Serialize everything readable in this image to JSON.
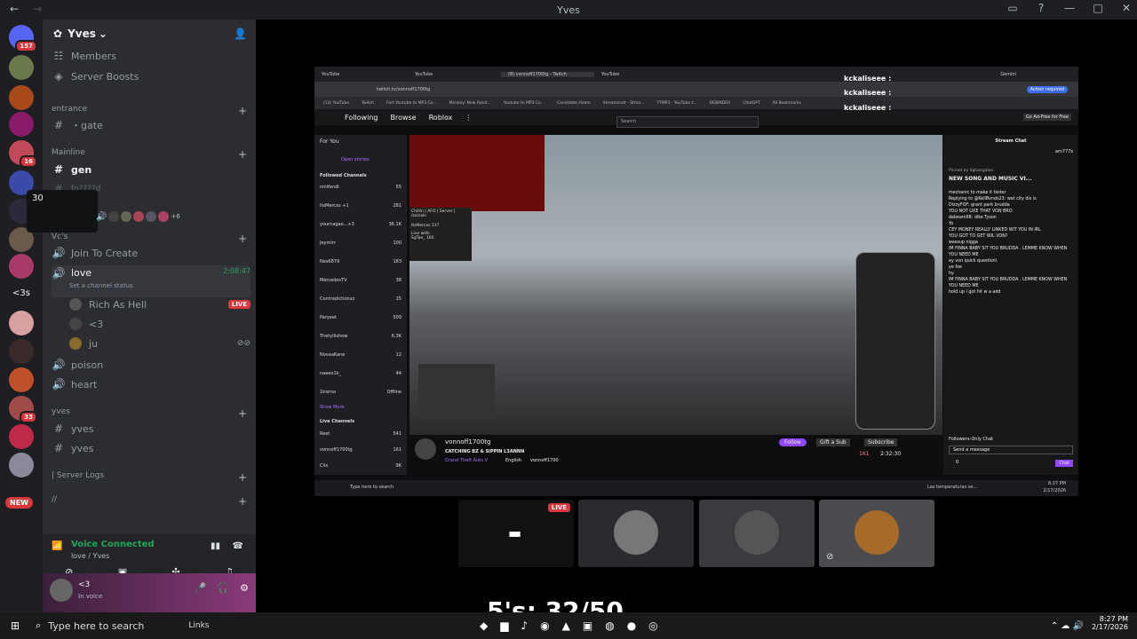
{
  "window": {
    "title": "Yves"
  },
  "servers": [
    {
      "badge": "157"
    },
    {
      "badge": ""
    },
    {
      "badge": ""
    },
    {
      "badge": "16"
    },
    {
      "badge": ""
    },
    {
      "badge": ""
    },
    {
      "badge": ""
    },
    {
      "badge": ""
    },
    {
      "badge": "<3s"
    },
    {
      "badge": ""
    },
    {
      "badge": ""
    },
    {
      "badge": ""
    },
    {
      "badge": "33"
    },
    {
      "badge": ""
    },
    {
      "badge": ""
    },
    {
      "badge": "NEW"
    }
  ],
  "guild": {
    "name": "Yves",
    "chevron": "⌄"
  },
  "channels": {
    "members": "Members",
    "boosts": "Server Boosts",
    "cat_entrance": "entrance",
    "gate": "・gate",
    "cat_mainline": "Mainline",
    "gen": "gen",
    "faded": "fo????d",
    "voice_count": "30",
    "voice_more": "+6",
    "cat_vcs": "Vc's",
    "join": "Join To Create",
    "love": "love",
    "love_time": "2:08:47",
    "set_status": "Set a channel status",
    "u1": "Rich As Hell",
    "u1_live": "LIVE",
    "u2": "<3",
    "u3": "ju",
    "poison": "poison",
    "heart": "heart",
    "cat_yves": "yves",
    "yves1": "yves",
    "yves2": "yves",
    "server_logs": "| Server Logs",
    "slash": "//"
  },
  "voice": {
    "status": "Voice Connected",
    "location": "love / Yves"
  },
  "user": {
    "name": "<3",
    "status": "In voice"
  },
  "stream": {
    "tabs": [
      "YouTube",
      "YouTube",
      "(8) vonnoff1700tg - Twitch",
      "YouTube"
    ],
    "url": "twitch.tv/vonnoff1700tg",
    "bookmarks": [
      "(13) YouTube",
      "Twitch",
      "Fort Youtube to MP3 Co...",
      "Monkey: New Rand...",
      "Youtube to MP3 Co...",
      "Candidate Home",
      "Streamsnet - Strea...",
      "YTMP3 - YouTube t...",
      "DEBINDER",
      "ChatGPT",
      "All Bookmarks"
    ],
    "gemini": "Gemini",
    "action": "Action required",
    "nav": [
      "Following",
      "Browse",
      "Roblox",
      "⋮"
    ],
    "search": "Search",
    "go_ad": "Go Ad-Free for Free",
    "left_title": "For You",
    "open_stories": "Open stories",
    "followed": "Followed Channels",
    "followed_list": [
      {
        "name": "ninifendi",
        "game": "Grand Theft Au...",
        "n": "55"
      },
      {
        "name": "ItsMercxs +1",
        "game": "Apex Legends",
        "n": "281"
      },
      {
        "name": "yournagae...+3",
        "game": "Just Chatting",
        "n": "36.1K"
      },
      {
        "name": "Jeymirr",
        "game": "Grand Theft Au...",
        "n": "100"
      },
      {
        "name": "Nes6879",
        "game": "Grand Theft Au...",
        "n": "183"
      },
      {
        "name": "MercedesTV",
        "game": "Grand Theft Au...",
        "n": "38"
      },
      {
        "name": "Contradictionxz",
        "game": "Just Chatting",
        "n": "15"
      },
      {
        "name": "Paryeet",
        "game": "Just Chatting",
        "n": "509"
      },
      {
        "name": "Thetyllishow",
        "game": "IRL",
        "n": "6.3K"
      },
      {
        "name": "NovaaKane",
        "game": "Grand Theft Au...",
        "n": "12"
      },
      {
        "name": "naeeo1k_",
        "game": "Just Chatting",
        "n": "44"
      },
      {
        "name": "1tremo",
        "game": "",
        "n": "Offline"
      }
    ],
    "show_more": "Show More",
    "live_channels": "Live Channels",
    "live_list": [
      {
        "name": "Reet",
        "game": "Fortnite",
        "n": "541"
      },
      {
        "name": "vonnoff1700tg",
        "game": "Grand Theft Au...",
        "n": "161"
      },
      {
        "name": "Clix",
        "game": "",
        "n": "9K"
      }
    ],
    "status_url": "https://www.twitch.tv/itsmercxs",
    "overlay_tag": "Chillin | AFO | Server | /socials",
    "overlay_user": "ItsMercxs",
    "overlay_n": "137",
    "live_with": "Live with:",
    "live_with_user": "SgTae_",
    "live_with_n": "160",
    "streamer": "vonnoff1700tg",
    "stream_title": "CATCHING BZ & SIPPIN L3ANNN",
    "stream_game": "Grand Theft Auto V",
    "stream_tags": [
      "English",
      "vonnoff1700"
    ],
    "follow": "Follow",
    "gift": "Gift a Sub",
    "subscribe": "Subscribe",
    "viewers": "161",
    "uptime": "2:32:30",
    "chat_title": "Stream Chat",
    "chat_top_user": "am777s",
    "pinned_by": "Pinned by",
    "pinned_user": "Sghangaloo",
    "pinned_msg": "NEW SONG AND MUSIC VI...",
    "chat": [
      "mechanic to make it faster",
      "Replying to @KellBvnds23: wat city dis is",
      "DizzyFOF: grant park brudda",
      "",
      "YOU NOT LIKE THAT VON BRO",
      "",
      "dabeam68: dike Tyson",
      "Yo",
      "CEY MONEY REALLY LINKED WIT YOU IN IRL",
      "YOU GOT TO GET WIL VON?",
      "wassup nigga",
      "IM FINNA BABY SIT YOU BRUDDA . LEMME KNOW WHEN YOU NEED ME",
      "ay von quick question\\",
      "ye foe",
      "hy",
      "IM FINNA BABY SIT YOU BRUDDA . LEMME KNOW WHEN YOU NEED ME",
      "hold up i got hit w a add"
    ],
    "followers_only": "Followers-Only Chat",
    "send_message": "Send a message",
    "chat_btn": "Chat",
    "chat_zero": "0",
    "inner_taskbar_search": "Type here to search",
    "inner_weather": "Las temperaturas se...",
    "inner_time": "8:27 PM",
    "inner_date": "2/17/2026"
  },
  "overlays": {
    "kc1": "kckaliseee :",
    "kc2": "kckaliseee :",
    "kc3": "kckaliseee :"
  },
  "tiles": {
    "live": "LIVE"
  },
  "counter": "5's: 32/50",
  "taskbar": {
    "search": "Type here to search",
    "links": "Links",
    "time": "8:27 PM",
    "date": "2/17/2026"
  }
}
